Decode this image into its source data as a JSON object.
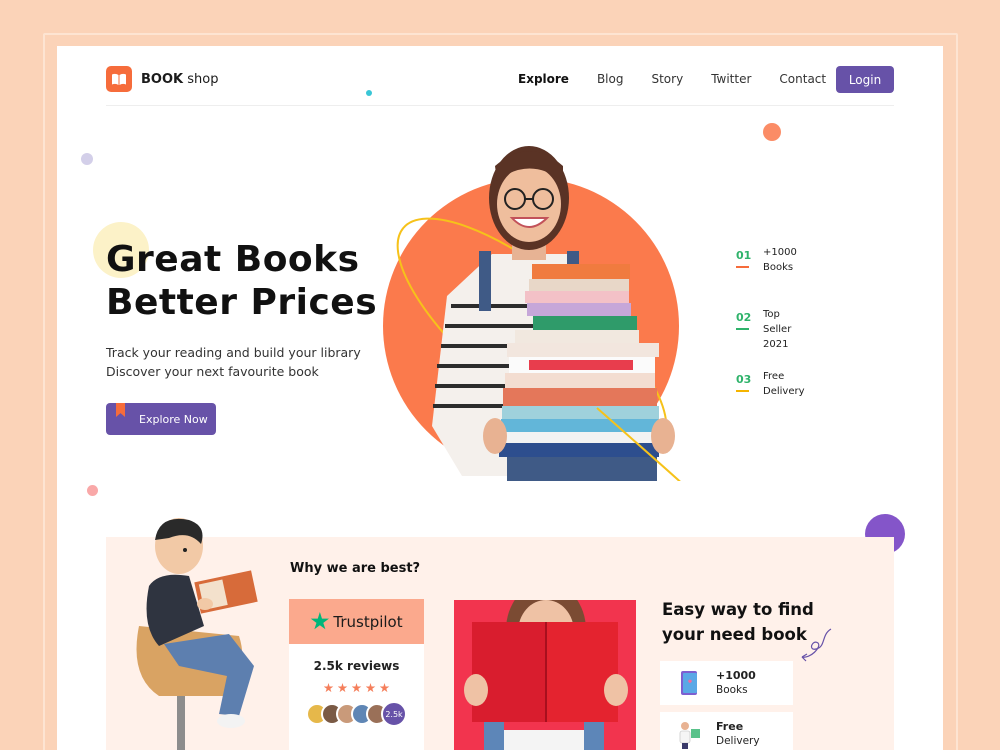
{
  "brand": {
    "name_bold": "BOOK",
    "name_rest": " shop"
  },
  "nav": {
    "items": [
      "Explore",
      "Blog",
      "Story",
      "Twitter",
      "Contact"
    ],
    "login": "Login"
  },
  "hero": {
    "title_line1": "Great Books",
    "title_line2": "Better Prices",
    "sub_line1": "Track your reading and build your library",
    "sub_line2": "Discover your next favourite book",
    "cta": "Explore Now"
  },
  "stats": [
    {
      "num": "01",
      "line1": "+1000",
      "line2": "Books",
      "color": "#f66c3b"
    },
    {
      "num": "02",
      "line1": "Top",
      "line2": "Seller 2021",
      "color": "#2fb36b"
    },
    {
      "num": "03",
      "line1": "Free",
      "line2": "Delivery",
      "color": "#f5b400"
    }
  ],
  "why": {
    "title": "Why we are best?",
    "trustpilot": "Trustpilot",
    "reviews": "2.5k reviews",
    "avatar_count": "2.5k"
  },
  "easy": {
    "line1": "Easy way to find",
    "line2": "your need book",
    "cards": [
      {
        "line1": "+1000",
        "line2": "Books"
      },
      {
        "line1": "Free",
        "line2": "Delivery"
      }
    ]
  },
  "colors": {
    "accent": "#6752a8",
    "brand_orange": "#f66c3b",
    "background": "#fbd3b8"
  }
}
